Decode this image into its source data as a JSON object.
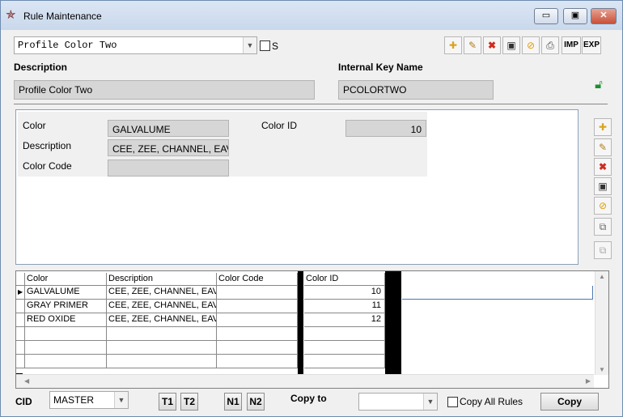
{
  "window": {
    "title": "Rule Maintenance",
    "min": "▭",
    "max": "▣",
    "close": "✕"
  },
  "rule_select": {
    "value": "Profile Color Two",
    "checkbox_label": "S"
  },
  "toolbar": {
    "imp": "IMP",
    "exp": "EXP"
  },
  "header": {
    "description_label": "Description",
    "description_value": "Profile Color Two",
    "key_label": "Internal Key Name",
    "key_value": "PCOLORTWO"
  },
  "detail": {
    "color_label": "Color",
    "color_value": "GALVALUME",
    "description_label": "Description",
    "description_value": "CEE, ZEE, CHANNEL, EAV",
    "code_label": "Color Code",
    "code_value": "",
    "id_label": "Color ID",
    "id_value": "10"
  },
  "grid": {
    "columns": [
      "Color",
      "Description",
      "Color Code",
      "Color ID"
    ],
    "rows": [
      {
        "color": "GALVALUME",
        "description": "CEE, ZEE, CHANNEL, EAVE",
        "code": "",
        "id": "10"
      },
      {
        "color": "GRAY PRIMER",
        "description": "CEE, ZEE, CHANNEL, EAVE",
        "code": "",
        "id": "11"
      },
      {
        "color": "RED OXIDE",
        "description": "CEE, ZEE, CHANNEL, EAVE",
        "code": "",
        "id": "12"
      }
    ]
  },
  "footer": {
    "cid_label": "CID",
    "cid_value": "MASTER",
    "t1": "T1",
    "t2": "T2",
    "n1": "N1",
    "n2": "N2",
    "copy_to_label": "Copy to",
    "copy_to_value": "",
    "copy_all_label": "Copy All Rules",
    "copy_button": "Copy"
  }
}
